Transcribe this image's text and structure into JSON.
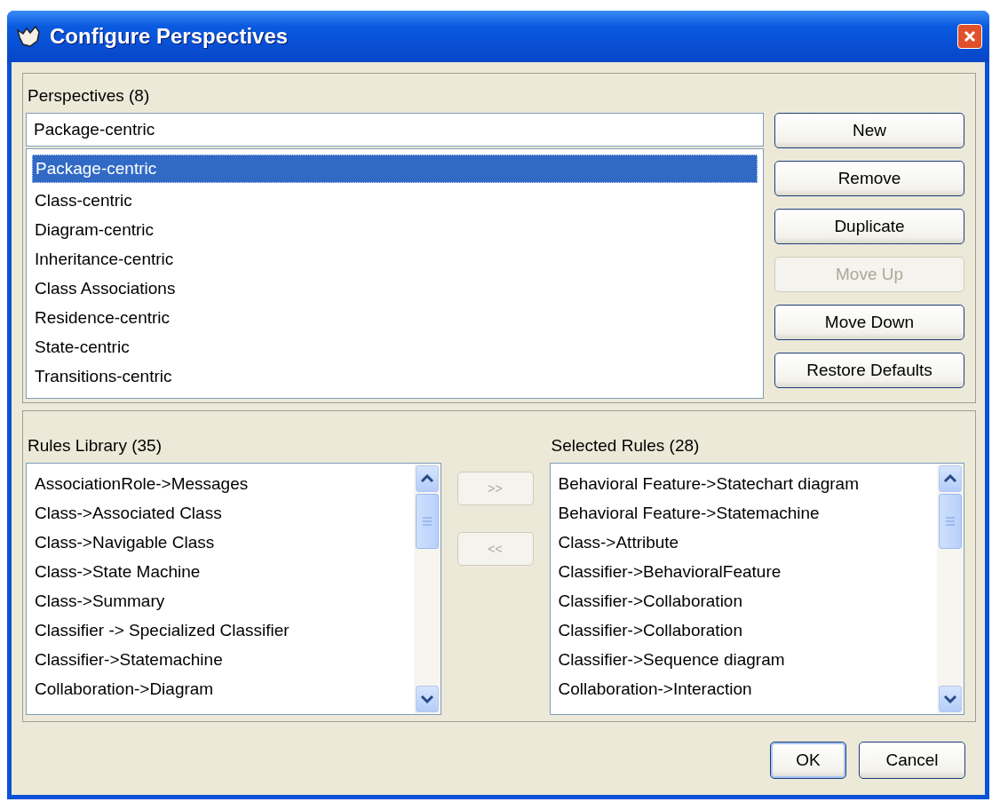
{
  "window": {
    "title": "Configure Perspectives"
  },
  "perspectives": {
    "heading": "Perspectives (8)",
    "name_field": {
      "value": "Package-centric"
    },
    "items": [
      {
        "label": "Package-centric",
        "selected": true
      },
      {
        "label": "Class-centric",
        "selected": false
      },
      {
        "label": "Diagram-centric",
        "selected": false
      },
      {
        "label": "Inheritance-centric",
        "selected": false
      },
      {
        "label": "Class Associations",
        "selected": false
      },
      {
        "label": "Residence-centric",
        "selected": false
      },
      {
        "label": "State-centric",
        "selected": false
      },
      {
        "label": "Transitions-centric",
        "selected": false
      }
    ],
    "buttons": [
      {
        "label": "New",
        "disabled": false
      },
      {
        "label": "Remove",
        "disabled": false
      },
      {
        "label": "Duplicate",
        "disabled": false
      },
      {
        "label": "Move Up",
        "disabled": true
      },
      {
        "label": "Move Down",
        "disabled": false
      },
      {
        "label": "Restore Defaults",
        "disabled": false
      }
    ]
  },
  "rules_library": {
    "heading": "Rules Library (35)",
    "items": [
      "AssociationRole->Messages",
      "Class->Associated Class",
      "Class->Navigable Class",
      "Class->State Machine",
      "Class->Summary",
      "Classifier -> Specialized Classifier",
      "Classifier->Statemachine",
      "Collaboration->Diagram"
    ]
  },
  "transfer_buttons": [
    {
      "label": ">>",
      "disabled": true
    },
    {
      "label": "<<",
      "disabled": true
    }
  ],
  "selected_rules": {
    "heading": "Selected Rules (28)",
    "items": [
      "Behavioral Feature->Statechart diagram",
      "Behavioral Feature->Statemachine",
      "Class->Attribute",
      "Classifier->BehavioralFeature",
      "Classifier->Collaboration",
      "Classifier->Collaboration",
      "Classifier->Sequence diagram",
      "Collaboration->Interaction"
    ]
  },
  "footer_buttons": [
    {
      "label": "OK",
      "default": true
    },
    {
      "label": "Cancel",
      "default": false
    }
  ]
}
